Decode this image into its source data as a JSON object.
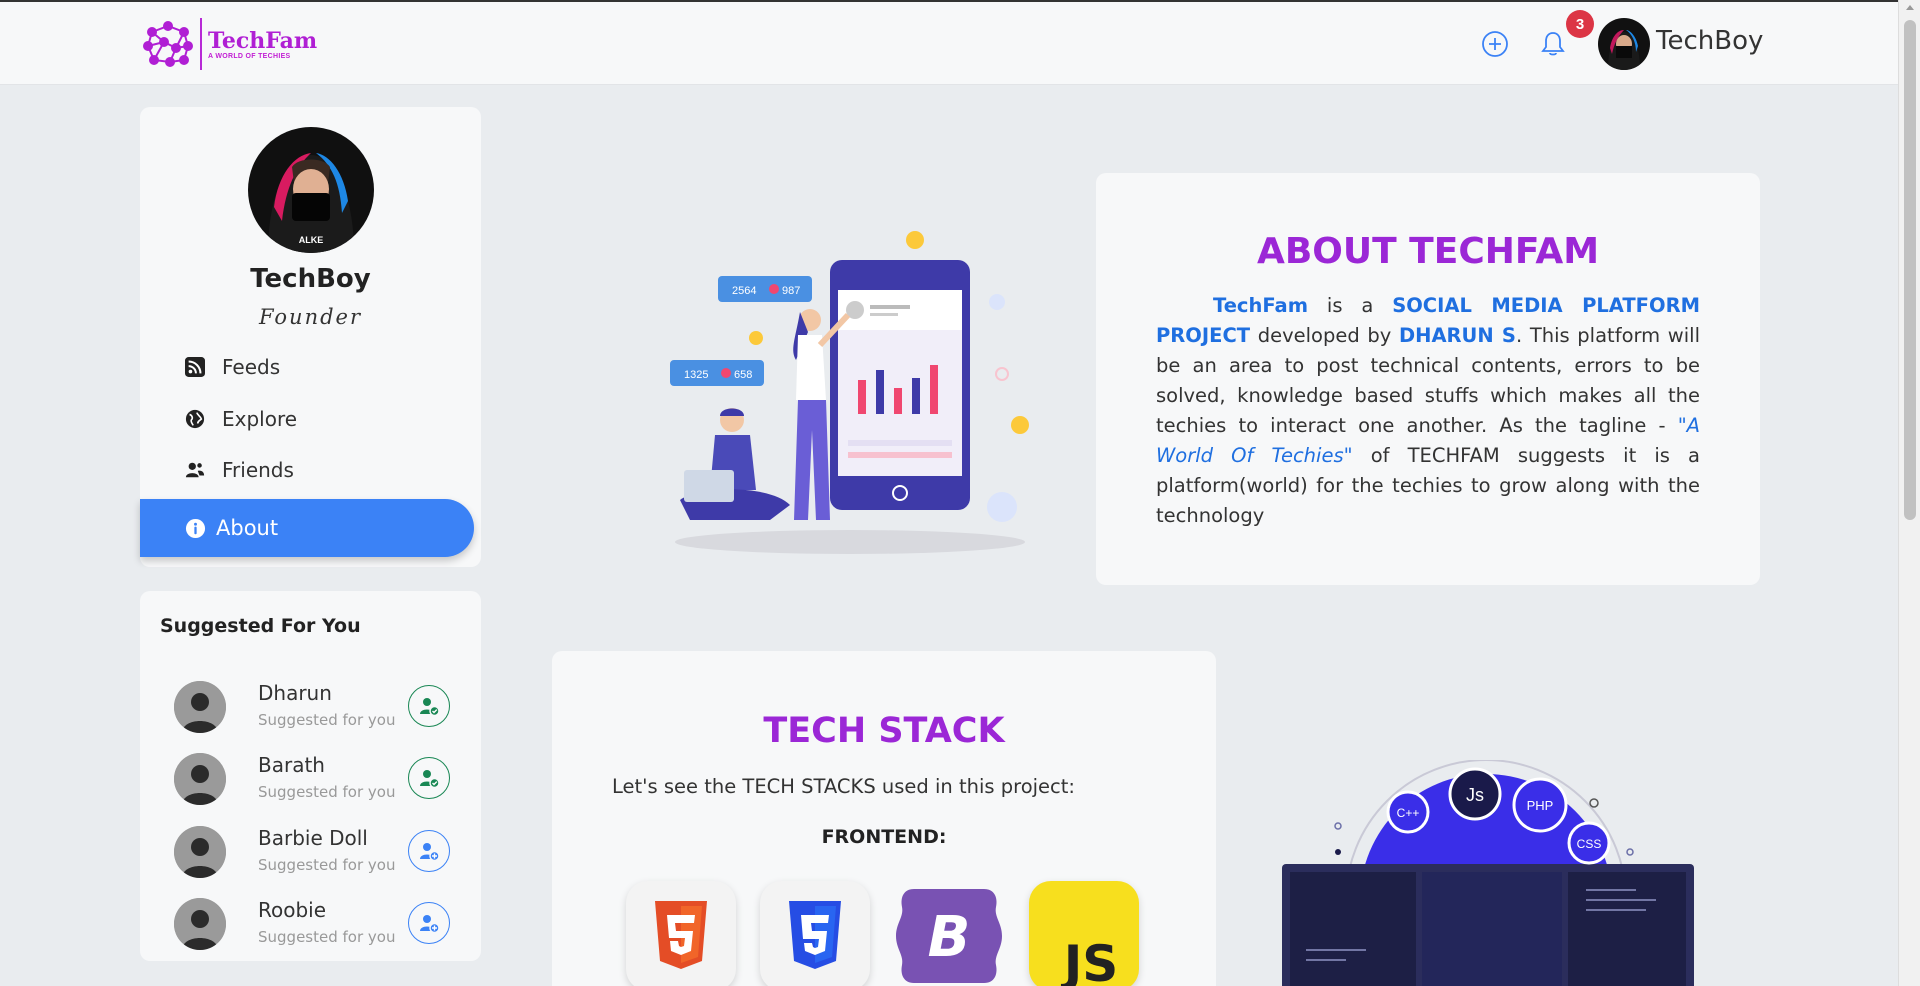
{
  "header": {
    "logo_title": "TechFam",
    "logo_tagline": "A WORLD OF TECHIES",
    "notification_count": "3",
    "username": "TechBoy"
  },
  "profile": {
    "name": "TechBoy",
    "role": "Founder",
    "avatar_caption": "ALKE"
  },
  "nav": {
    "items": [
      {
        "label": "Feeds",
        "icon": "rss-icon"
      },
      {
        "label": "Explore",
        "icon": "globe-icon"
      },
      {
        "label": "Friends",
        "icon": "friends-icon"
      },
      {
        "label": "About",
        "icon": "info-icon",
        "active": true
      }
    ]
  },
  "suggested": {
    "title": "Suggested For You",
    "users": [
      {
        "name": "Dharun",
        "sub": "Suggested for you",
        "status": "added"
      },
      {
        "name": "Barath",
        "sub": "Suggested for you",
        "status": "added"
      },
      {
        "name": "Barbie Doll",
        "sub": "Suggested for you",
        "status": "add"
      },
      {
        "name": "Roobie",
        "sub": "Suggested for you",
        "status": "add"
      }
    ]
  },
  "hero": {
    "likes_1": "2564",
    "hearts_1": "987",
    "likes_2": "1325",
    "hearts_2": "658"
  },
  "about": {
    "title": "ABOUT TECHFAM",
    "p1": "TechFam",
    "p2": " is a ",
    "p3": "SOCIAL MEDIA PLATFORM PROJECT",
    "p4": " developed by ",
    "p5": "DHARUN S",
    "p6": ". This platform will be an area to post technical contents, errors to be solved, knowledge based stuffs which makes all the techies to interact one another. As the tagline - ",
    "p7": "\"A World Of Techies\"",
    "p8": " of TECHFAM suggests it is a platform(world) for the techies to grow along with the technology"
  },
  "stack": {
    "title": "TECH STACK",
    "intro": "Let's see the TECH STACKS used in this project:",
    "frontend_label": "FRONTEND:",
    "tiles": [
      "HTML5",
      "CSS3",
      "Bootstrap",
      "JS"
    ],
    "orbit_labels": [
      "C++",
      "Js",
      "PHP",
      "CSS"
    ]
  },
  "colors": {
    "accent_purple": "#9b27d6",
    "accent_blue": "#3b82f6",
    "badge_red": "#dc3545",
    "success_green": "#198754"
  }
}
